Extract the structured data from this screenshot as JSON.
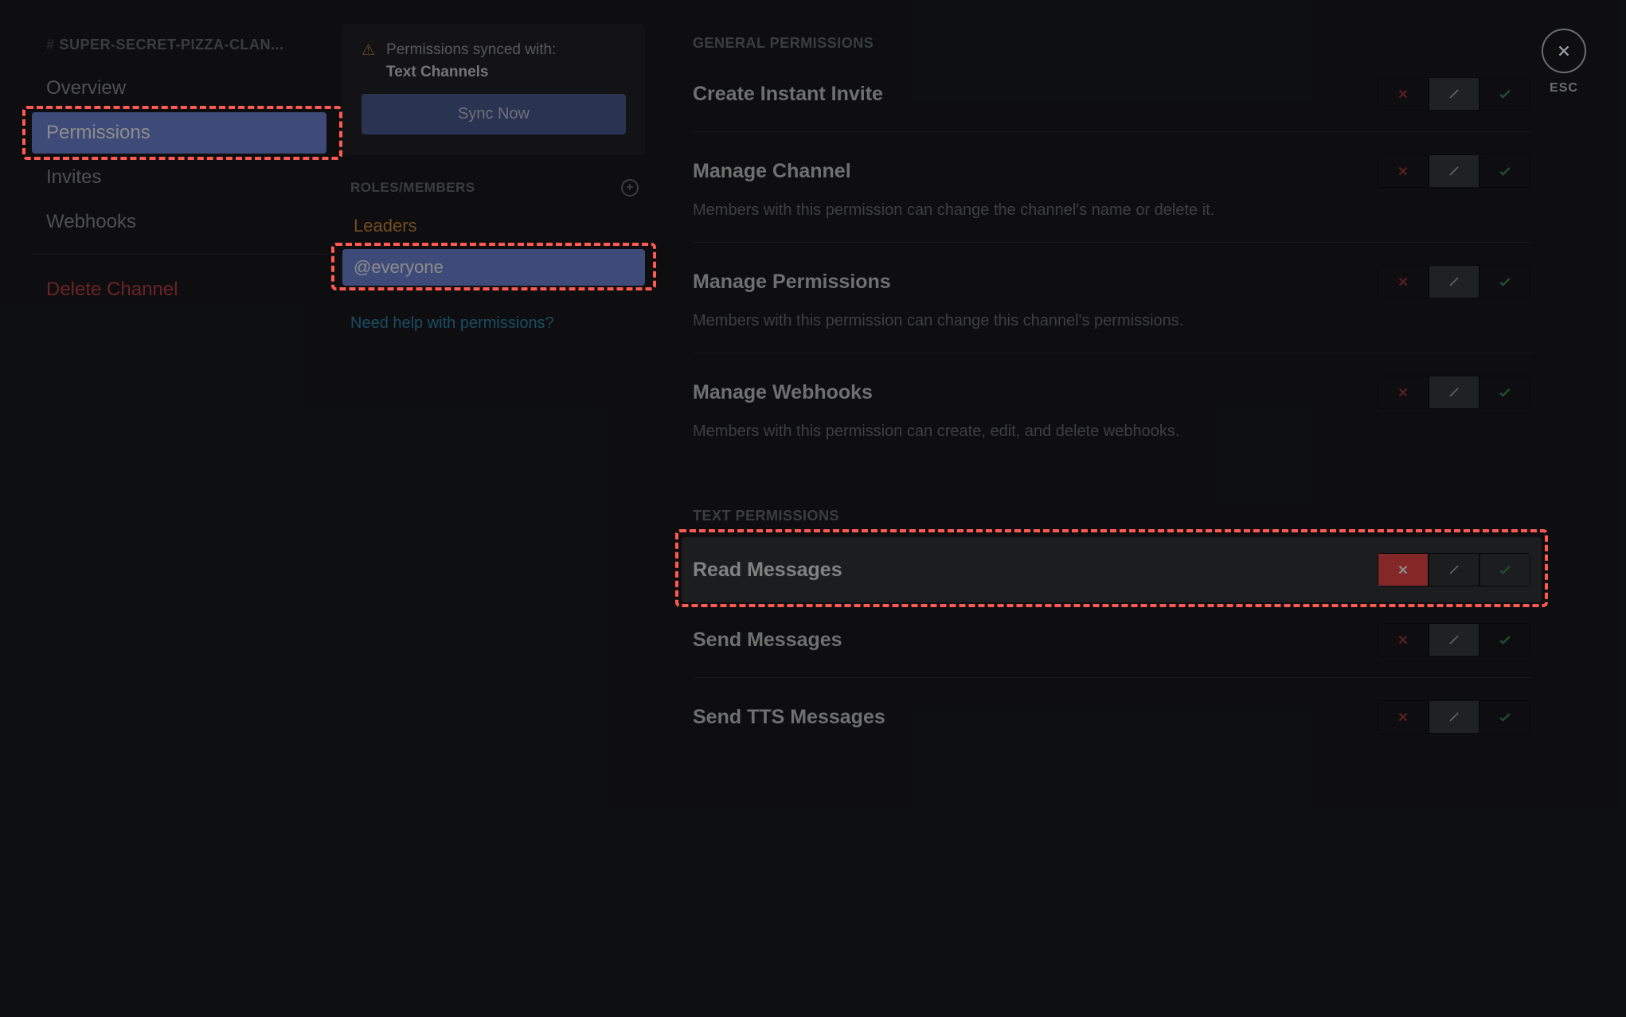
{
  "sidebar": {
    "channel_name": "SUPER-SECRET-PIZZA-CLAN...",
    "items": [
      {
        "label": "Overview",
        "active": false
      },
      {
        "label": "Permissions",
        "active": true
      },
      {
        "label": "Invites",
        "active": false
      },
      {
        "label": "Webhooks",
        "active": false
      }
    ],
    "delete_label": "Delete Channel"
  },
  "sync_card": {
    "line1": "Permissions synced with:",
    "line2": "Text Channels",
    "button": "Sync Now"
  },
  "roles": {
    "heading": "ROLES/MEMBERS",
    "items": [
      {
        "label": "Leaders",
        "type": "leaders",
        "active": false
      },
      {
        "label": "@everyone",
        "type": "everyone",
        "active": true
      }
    ],
    "help_link": "Need help with permissions?"
  },
  "permissions": {
    "sections": [
      {
        "heading": "GENERAL PERMISSIONS",
        "rows": [
          {
            "title": "Create Instant Invite",
            "desc": "",
            "state": "neutral",
            "highlighted": false
          },
          {
            "title": "Manage Channel",
            "desc": "Members with this permission can change the channel's name or delete it.",
            "state": "neutral",
            "highlighted": false
          },
          {
            "title": "Manage Permissions",
            "desc": "Members with this permission can change this channel's permissions.",
            "state": "neutral",
            "highlighted": false
          },
          {
            "title": "Manage Webhooks",
            "desc": "Members with this permission can create, edit, and delete webhooks.",
            "state": "neutral",
            "highlighted": false
          }
        ]
      },
      {
        "heading": "TEXT PERMISSIONS",
        "rows": [
          {
            "title": "Read Messages",
            "desc": "",
            "state": "deny",
            "highlighted": true
          },
          {
            "title": "Send Messages",
            "desc": "",
            "state": "neutral",
            "highlighted": false
          },
          {
            "title": "Send TTS Messages",
            "desc": "",
            "state": "neutral",
            "highlighted": false
          }
        ]
      }
    ]
  },
  "close": {
    "esc": "ESC"
  }
}
